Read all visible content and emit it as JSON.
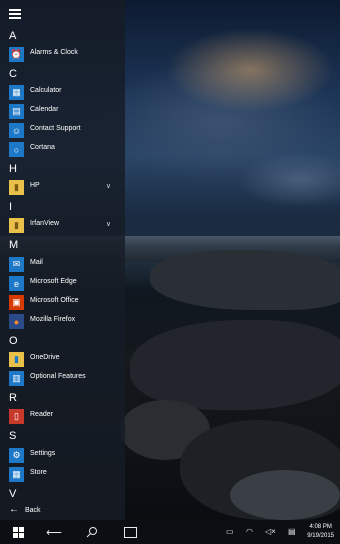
{
  "start_menu": {
    "groups": [
      {
        "letter": "A",
        "items": [
          {
            "label": "Alarms & Clock",
            "icon": "alarm-clock-icon"
          }
        ]
      },
      {
        "letter": "C",
        "items": [
          {
            "label": "Calculator",
            "icon": "calculator-icon"
          },
          {
            "label": "Calendar",
            "icon": "calendar-icon"
          },
          {
            "label": "Contact Support",
            "icon": "contact-support-icon"
          },
          {
            "label": "Cortana",
            "icon": "cortana-icon"
          }
        ]
      },
      {
        "letter": "H",
        "items": [
          {
            "label": "HP",
            "icon": "folder-icon",
            "expandable": true
          }
        ]
      },
      {
        "letter": "I",
        "items": [
          {
            "label": "IrfanView",
            "icon": "folder-icon",
            "expandable": true
          }
        ]
      },
      {
        "letter": "M",
        "items": [
          {
            "label": "Mail",
            "icon": "mail-icon"
          },
          {
            "label": "Microsoft Edge",
            "icon": "edge-icon"
          },
          {
            "label": "Microsoft Office",
            "icon": "office-icon"
          },
          {
            "label": "Mozilla Firefox",
            "icon": "firefox-icon"
          }
        ]
      },
      {
        "letter": "O",
        "items": [
          {
            "label": "OneDrive",
            "icon": "folder-icon"
          },
          {
            "label": "Optional Features",
            "icon": "optional-features-icon"
          }
        ]
      },
      {
        "letter": "R",
        "items": [
          {
            "label": "Reader",
            "icon": "reader-icon"
          }
        ]
      },
      {
        "letter": "S",
        "items": [
          {
            "label": "Settings",
            "icon": "gear-icon"
          },
          {
            "label": "Store",
            "icon": "store-icon"
          }
        ]
      },
      {
        "letter": "V",
        "items": []
      }
    ],
    "back_label": "Back"
  },
  "taskbar": {
    "time": "4:08 PM",
    "date": "9/19/2015"
  },
  "colors": {
    "accent": "#1e78c8",
    "menu_bg": "#161c26"
  }
}
